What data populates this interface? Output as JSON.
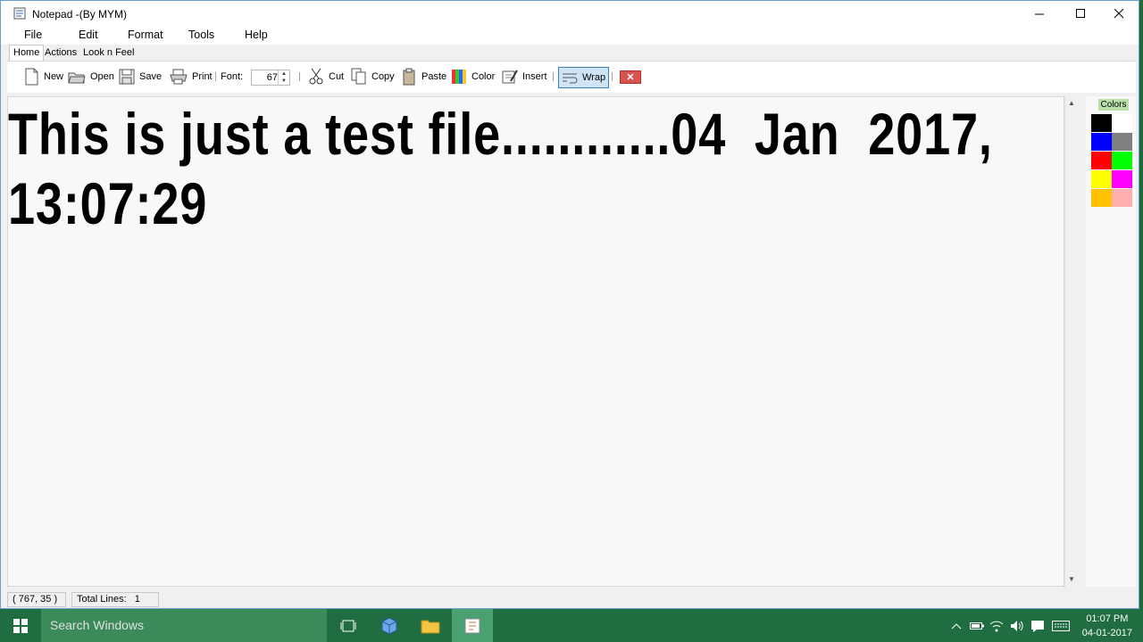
{
  "window": {
    "title": "Notepad -(By MYM)"
  },
  "menu": [
    "File",
    "Edit",
    "Format",
    "Tools",
    "Help"
  ],
  "tabs": [
    "Home",
    "Actions",
    "Look n Feel"
  ],
  "toolbar": {
    "new": "New",
    "open": "Open",
    "save": "Save",
    "print": "Print",
    "font_label": "Font:",
    "font_size": "67",
    "cut": "Cut",
    "copy": "Copy",
    "paste": "Paste",
    "color": "Color",
    "insert": "Insert",
    "wrap": "Wrap",
    "close_glyph": "✕"
  },
  "editor": {
    "text": "This is just a test file............04  Jan  2017, 13:07:29"
  },
  "palette": {
    "title": "Colors",
    "swatches": [
      "#000000",
      "#ffffff",
      "#0000ff",
      "#808080",
      "#ff0000",
      "#00ff00",
      "#ffff00",
      "#ff00ff",
      "#ffc000",
      "#ffafaf"
    ]
  },
  "status": {
    "cursor": "( 767, 35 )",
    "total_lines_label": "Total Lines:",
    "total_lines": "1"
  },
  "taskbar": {
    "search_placeholder": "Search Windows",
    "time": "01:07 PM",
    "date": "04-01-2017"
  }
}
